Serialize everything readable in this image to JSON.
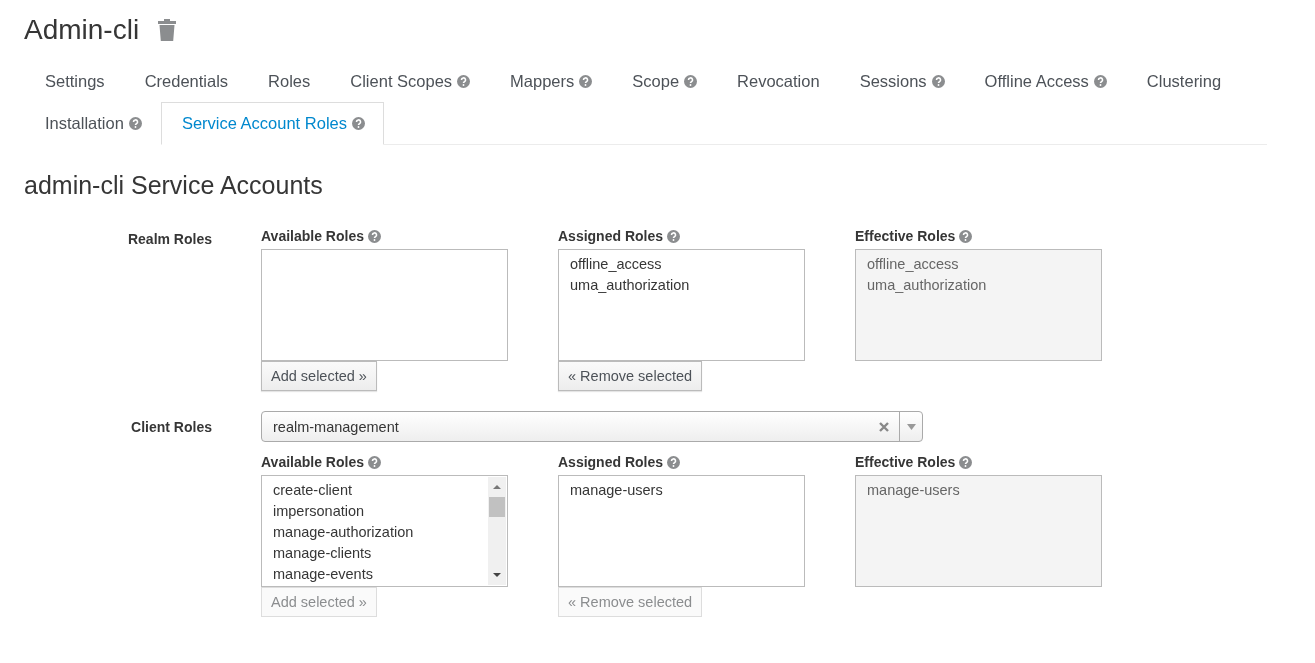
{
  "title": "Admin-cli",
  "tabs": [
    {
      "label": "Settings",
      "help": false,
      "selected": false
    },
    {
      "label": "Credentials",
      "help": false,
      "selected": false
    },
    {
      "label": "Roles",
      "help": false,
      "selected": false
    },
    {
      "label": "Client Scopes",
      "help": true,
      "selected": false
    },
    {
      "label": "Mappers",
      "help": true,
      "selected": false
    },
    {
      "label": "Scope",
      "help": true,
      "selected": false
    },
    {
      "label": "Revocation",
      "help": false,
      "selected": false
    },
    {
      "label": "Sessions",
      "help": true,
      "selected": false
    },
    {
      "label": "Offline Access",
      "help": true,
      "selected": false
    },
    {
      "label": "Clustering",
      "help": false,
      "selected": false
    },
    {
      "label": "Installation",
      "help": true,
      "selected": false
    },
    {
      "label": "Service Account Roles",
      "help": true,
      "selected": true
    }
  ],
  "section_title": "admin-cli Service Accounts",
  "groups": [
    {
      "label": "Realm Roles",
      "columns": [
        {
          "kind": "available",
          "heading": "Available Roles",
          "scrollbar": false,
          "button": {
            "label": "Add selected »",
            "disabled": false
          }
        },
        {
          "kind": "assigned",
          "heading": "Assigned Roles",
          "items": [
            "offline_access",
            "uma_authorization"
          ],
          "scrollbar": false,
          "button": {
            "label": "« Remove selected",
            "disabled": false
          }
        },
        {
          "kind": "effective",
          "heading": "Effective Roles",
          "items": [
            "offline_access",
            "uma_authorization"
          ],
          "scrollbar": false
        }
      ]
    },
    {
      "label": "Client Roles",
      "client_select": {
        "value": "realm-management"
      },
      "columns": [
        {
          "kind": "available",
          "heading": "Available Roles",
          "items": [
            "create-client",
            "impersonation",
            "manage-authorization",
            "manage-clients",
            "manage-events"
          ],
          "scrollbar": true,
          "button": {
            "label": "Add selected »",
            "disabled": true
          }
        },
        {
          "kind": "assigned",
          "heading": "Assigned Roles",
          "items": [
            "manage-users"
          ],
          "scrollbar": false,
          "button": {
            "label": "« Remove selected",
            "disabled": true
          }
        },
        {
          "kind": "effective",
          "heading": "Effective Roles",
          "items": [
            "manage-users"
          ],
          "scrollbar": false
        }
      ]
    }
  ]
}
